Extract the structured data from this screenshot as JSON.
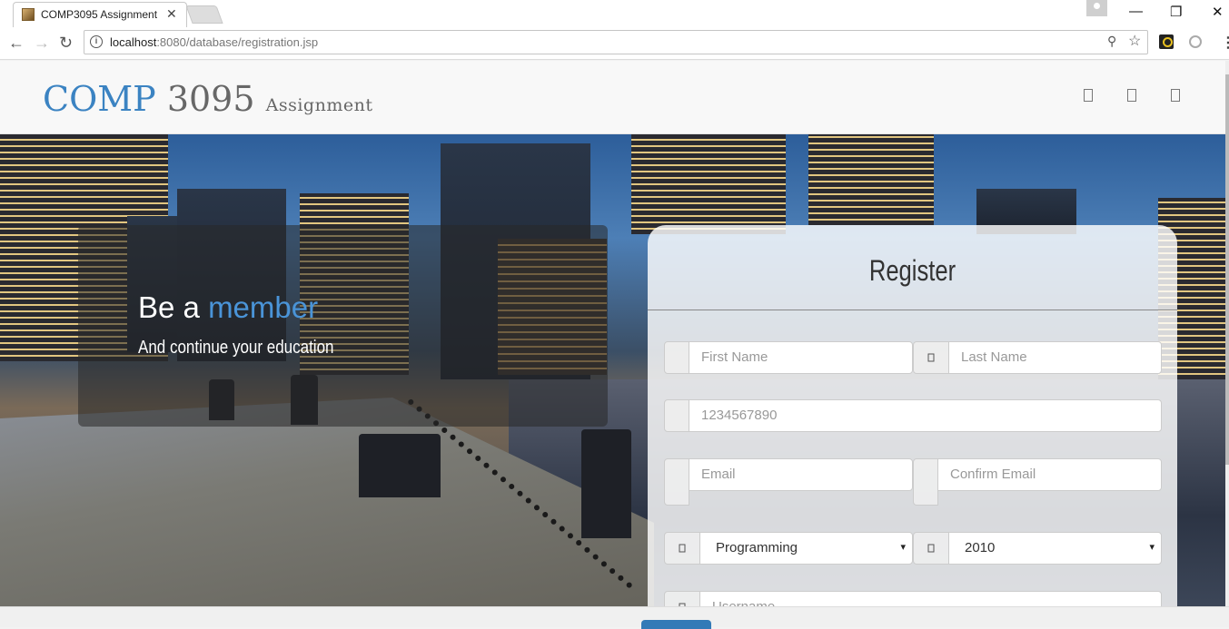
{
  "browser": {
    "tab_title": "COMP3095 Assignment",
    "tab_close": "✕",
    "url_host": "localhost",
    "url_rest": ":8080/database/registration.jsp",
    "window_controls": {
      "minimize": "—",
      "restore": "❐",
      "close": "✕"
    },
    "nav": {
      "back": "←",
      "forward": "→",
      "reload": "↻"
    },
    "icons": [
      "info-icon",
      "zoom-icon",
      "star-icon",
      "extension-icon",
      "extension-icon-2",
      "menu-icon"
    ],
    "zoom_glyph": "⚲",
    "star_glyph": "☆",
    "menu_glyph": "⋮"
  },
  "header": {
    "brand_part1": "COMP",
    "brand_part2": "3095",
    "brand_part3": "Assignment",
    "icons": [
      "header-icon-1",
      "header-icon-2",
      "header-icon-3"
    ]
  },
  "hero": {
    "title_prefix": "Be a ",
    "title_accent": "member",
    "subtitle": "And continue your education"
  },
  "register": {
    "title": "Register",
    "first_name_placeholder": "First Name",
    "last_name_placeholder": "Last Name",
    "phone_placeholder": "1234567890",
    "email_placeholder": "Email",
    "confirm_email_placeholder": "Confirm Email",
    "program_value": "Programming",
    "year_value": "2010",
    "username_placeholder": "Username",
    "caret": "▾"
  },
  "colors": {
    "accent": "#3b83c2",
    "member": "#4a94d8",
    "submit": "#337ab7"
  }
}
